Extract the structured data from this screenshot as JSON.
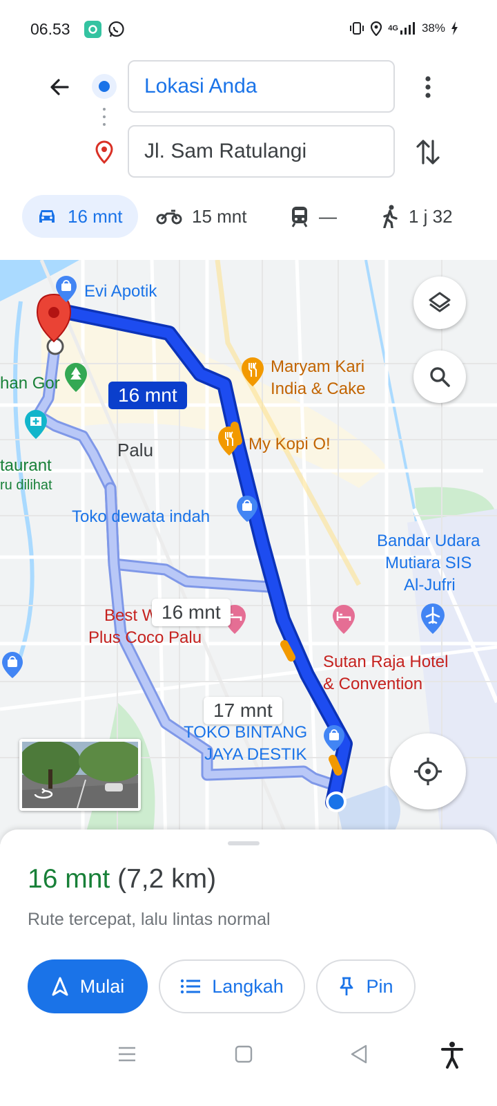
{
  "status_bar": {
    "time": "06.53",
    "battery": "38%",
    "network": "4G"
  },
  "directions": {
    "origin": "Lokasi Anda",
    "destination": "Jl. Sam Ratulangi"
  },
  "modes": {
    "car": "16 mnt",
    "motorbike": "15 mnt",
    "transit": "—",
    "walk": "1 j 32"
  },
  "map": {
    "pois": {
      "evi_apotik": "Evi Apotik",
      "maryam_1": "Maryam Kari",
      "maryam_2": "India & Cake",
      "my_kopi": "My Kopi O!",
      "han_gor": "han Gor",
      "palu": "Palu",
      "taurant": "taurant",
      "ru_dilihat": "ru dilihat",
      "toko_dewata": "Toko dewata indah",
      "bandar_1": "Bandar Udara",
      "bandar_2": "Mutiara SIS",
      "bandar_3": "Al-Jufri",
      "best_1": "Best W",
      "best_2": "Plus Coco Palu",
      "sutan_1": "Sutan Raja Hotel",
      "sutan_2": "& Convention",
      "toko_bintang_1": "TOKO BINTANG",
      "toko_bintang_2": "JAYA DESTIK"
    },
    "route_labels": {
      "primary": "16 mnt",
      "alt1": "16 mnt",
      "alt2": "17 mnt"
    }
  },
  "sheet": {
    "duration": "16 mnt",
    "distance": "(7,2 km)",
    "description": "Rute tercepat, lalu lintas normal",
    "start_label": "Mulai",
    "steps_label": "Langkah",
    "pin_label": "Pin"
  },
  "colors": {
    "accent": "#1a73e8",
    "route_primary": "#1a46e6",
    "route_alt": "#a9bcf5",
    "duration_green": "#188038",
    "poi_blue": "#4285f4",
    "poi_orange": "#f29900",
    "poi_pink": "#e56e94"
  }
}
